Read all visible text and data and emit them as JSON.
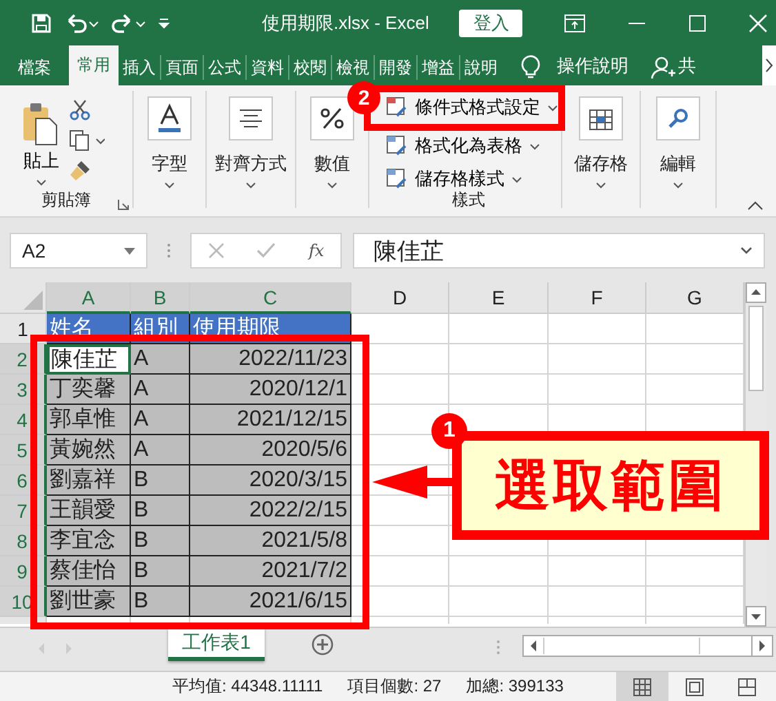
{
  "title_bar": {
    "file_title": "使用期限.xlsx  -  Excel",
    "sign_in": "登入"
  },
  "ribbon_tabs": [
    {
      "label": "檔案",
      "selected": false
    },
    {
      "label": "常用",
      "selected": true
    },
    {
      "label": "插入",
      "selected": false
    },
    {
      "label": "頁面",
      "selected": false
    },
    {
      "label": "公式",
      "selected": false
    },
    {
      "label": "資料",
      "selected": false
    },
    {
      "label": "校閱",
      "selected": false
    },
    {
      "label": "檢視",
      "selected": false
    },
    {
      "label": "開發",
      "selected": false
    },
    {
      "label": "增益",
      "selected": false
    },
    {
      "label": "說明",
      "selected": false
    }
  ],
  "tell_me": "操作說明",
  "share": "共",
  "ribbon": {
    "paste": "貼上",
    "clipboard_label": "剪貼簿",
    "font": "字型",
    "alignment": "對齊方式",
    "number": "數值",
    "styles": [
      "條件式格式設定",
      "格式化為表格",
      "儲存格樣式"
    ],
    "styles_label": "樣式",
    "cells": "儲存格",
    "editing": "編輯"
  },
  "formula_bar": {
    "name_box": "A2",
    "fx": "fx",
    "content": "陳佳芷"
  },
  "columns": [
    {
      "label": "A",
      "selected": true
    },
    {
      "label": "B",
      "selected": true
    },
    {
      "label": "C",
      "selected": true
    },
    {
      "label": "D",
      "selected": false
    },
    {
      "label": "E",
      "selected": false
    },
    {
      "label": "F",
      "selected": false
    },
    {
      "label": "G",
      "selected": false
    }
  ],
  "rows": [
    {
      "number": "1",
      "kind": "header",
      "selected": false,
      "cells": [
        {
          "text": "姓名",
          "active": false
        },
        {
          "text": "組別",
          "active": false
        },
        {
          "text": "使用期限",
          "active": false
        }
      ]
    },
    {
      "number": "2",
      "kind": "data",
      "selected": true,
      "cells": [
        {
          "text": "陳佳芷",
          "active": true
        },
        {
          "text": "A",
          "active": false
        },
        {
          "text": "2022/11/23",
          "active": false
        }
      ]
    },
    {
      "number": "3",
      "kind": "data",
      "selected": true,
      "cells": [
        {
          "text": "丁奕馨",
          "active": false
        },
        {
          "text": "A",
          "active": false
        },
        {
          "text": "2020/12/1",
          "active": false
        }
      ]
    },
    {
      "number": "4",
      "kind": "data",
      "selected": true,
      "cells": [
        {
          "text": "郭卓惟",
          "active": false
        },
        {
          "text": "A",
          "active": false
        },
        {
          "text": "2021/12/15",
          "active": false
        }
      ]
    },
    {
      "number": "5",
      "kind": "data",
      "selected": true,
      "cells": [
        {
          "text": "黃婉然",
          "active": false
        },
        {
          "text": "A",
          "active": false
        },
        {
          "text": "2020/5/6",
          "active": false
        }
      ]
    },
    {
      "number": "6",
      "kind": "data",
      "selected": true,
      "cells": [
        {
          "text": "劉嘉祥",
          "active": false
        },
        {
          "text": "B",
          "active": false
        },
        {
          "text": "2020/3/15",
          "active": false
        }
      ]
    },
    {
      "number": "7",
      "kind": "data",
      "selected": true,
      "cells": [
        {
          "text": "王韻愛",
          "active": false
        },
        {
          "text": "B",
          "active": false
        },
        {
          "text": "2022/2/15",
          "active": false
        }
      ]
    },
    {
      "number": "8",
      "kind": "data",
      "selected": true,
      "cells": [
        {
          "text": "李宜念",
          "active": false
        },
        {
          "text": "B",
          "active": false
        },
        {
          "text": "2021/5/8",
          "active": false
        }
      ]
    },
    {
      "number": "9",
      "kind": "data",
      "selected": true,
      "cells": [
        {
          "text": "蔡佳怡",
          "active": false
        },
        {
          "text": "B",
          "active": false
        },
        {
          "text": "2021/7/2",
          "active": false
        }
      ]
    },
    {
      "number": "10",
      "kind": "data",
      "selected": true,
      "cells": [
        {
          "text": "劉世豪",
          "active": false
        },
        {
          "text": "B",
          "active": false
        },
        {
          "text": "2021/6/15",
          "active": false
        }
      ]
    }
  ],
  "sheet_tabs": [
    {
      "label": "工作表1",
      "selected": true
    }
  ],
  "status_bar": {
    "average": "平均值: 44348.11111",
    "count": "項目個數: 27",
    "sum": "加總: 399133"
  },
  "views": [
    {
      "kind": "normal",
      "selected": true
    },
    {
      "kind": "page_layout",
      "selected": false
    },
    {
      "kind": "page_break",
      "selected": false
    }
  ],
  "annotations": {
    "callout_number": "1",
    "callout_label": "選取範圍",
    "ribbon_number": "2"
  }
}
